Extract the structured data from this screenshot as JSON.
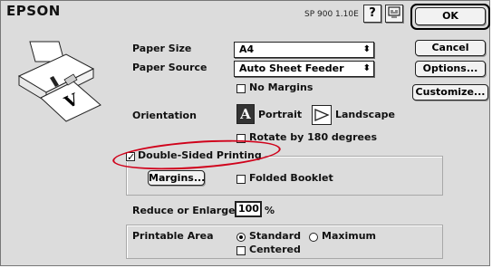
{
  "header": {
    "brand": "EPSON",
    "version": "SP 900 1.10E",
    "help_glyph": "?",
    "ok_label": "OK"
  },
  "buttons": {
    "cancel": "Cancel",
    "options": "Options...",
    "customize": "Customize...",
    "margins": "Margins..."
  },
  "paper": {
    "size_label": "Paper Size",
    "size_value": "A4",
    "source_label": "Paper Source",
    "source_value": "Auto Sheet Feeder",
    "no_margins_label": "No Margins",
    "no_margins_checked": false
  },
  "orientation": {
    "label": "Orientation",
    "portrait_label": "Portrait",
    "portrait_glyph": "A",
    "landscape_label": "Landscape",
    "rotate_label": "Rotate by 180 degrees",
    "rotate_checked": false,
    "selected": "Portrait"
  },
  "duplex": {
    "label": "Double-Sided Printing",
    "checked": true,
    "folded_label": "Folded Booklet",
    "folded_checked": false
  },
  "reduce": {
    "label": "Reduce or Enlarge",
    "value": "100",
    "unit": "%"
  },
  "printable": {
    "label": "Printable Area",
    "standard_label": "Standard",
    "maximum_label": "Maximum",
    "selected": "Standard",
    "centered_label": "Centered",
    "centered_checked": false
  },
  "illustration": {
    "page_letter": "V"
  },
  "colors": {
    "dialog_bg": "#dcdcdc",
    "highlight": "#d0021b"
  }
}
